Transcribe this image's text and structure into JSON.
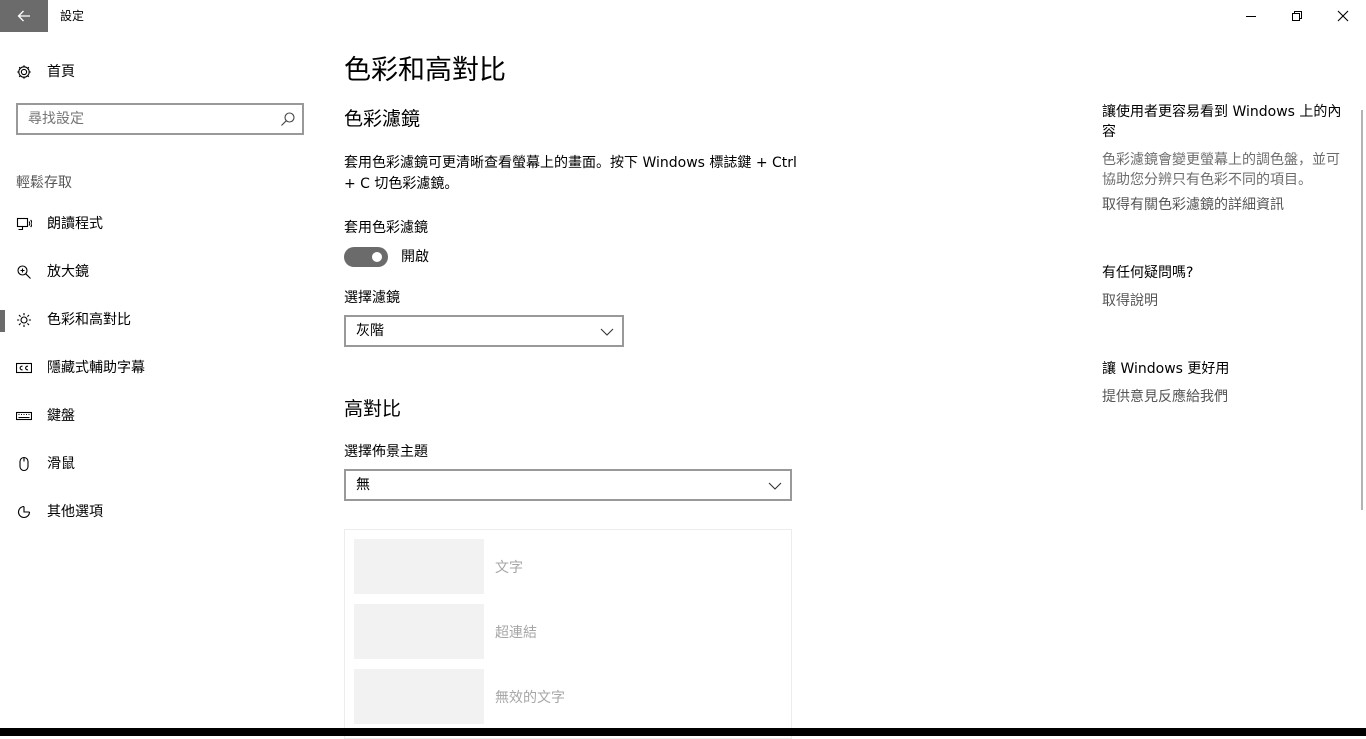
{
  "window": {
    "title": "設定",
    "icons": {
      "back": "back-arrow-icon",
      "minimize": "minimize-icon",
      "maximize": "restore-icon",
      "close": "close-icon"
    }
  },
  "sidebar": {
    "home_label": "首頁",
    "search_placeholder": "尋找設定",
    "section_label": "輕鬆存取",
    "items": [
      {
        "label": "朗讀程式",
        "icon": "narrator-icon"
      },
      {
        "label": "放大鏡",
        "icon": "magnifier-icon"
      },
      {
        "label": "色彩和高對比",
        "icon": "brightness-icon",
        "active": true
      },
      {
        "label": "隱藏式輔助字幕",
        "icon": "closed-captions-icon"
      },
      {
        "label": "鍵盤",
        "icon": "keyboard-icon"
      },
      {
        "label": "滑鼠",
        "icon": "mouse-icon"
      },
      {
        "label": "其他選項",
        "icon": "other-options-icon"
      }
    ]
  },
  "main": {
    "page_title": "色彩和高對比",
    "color_filters": {
      "heading": "色彩濾鏡",
      "description": "套用色彩濾鏡可更清晰查看螢幕上的畫面。按下 Windows 標誌鍵 + Ctrl + C 切色彩濾鏡。",
      "toggle_label": "套用色彩濾鏡",
      "toggle_state": "開啟",
      "toggle_on": true,
      "select_label": "選擇濾鏡",
      "select_value": "灰階"
    },
    "high_contrast": {
      "heading": "高對比",
      "select_label": "選擇佈景主題",
      "select_value": "無",
      "preview_items": [
        "文字",
        "超連結",
        "無效的文字"
      ]
    }
  },
  "right_column": {
    "heading1": "讓使用者更容易看到 Windows 上的內容",
    "text1": "色彩濾鏡會變更螢幕上的調色盤，並可協助您分辨只有色彩不同的項目。",
    "link1": "取得有關色彩濾鏡的詳細資訊",
    "heading2": "有任何疑問嗎?",
    "link2": "取得說明",
    "heading3": "讓 Windows 更好用",
    "link3": "提供意見反應給我們"
  },
  "colors": {
    "accent_gray": "#6b6b6b",
    "border": "#999999",
    "muted_text": "#6d6d6d",
    "preview_swatch": "#f2f2f2"
  }
}
